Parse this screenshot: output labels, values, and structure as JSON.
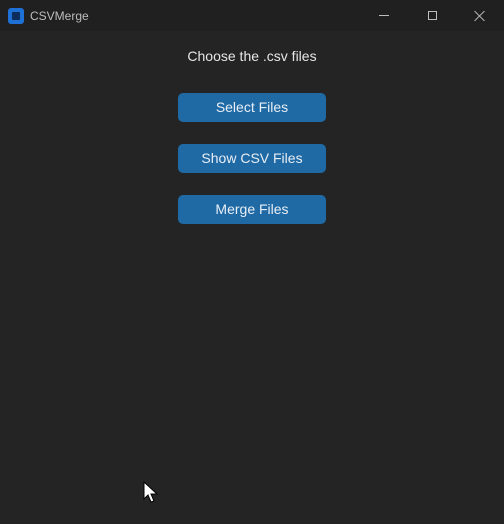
{
  "window": {
    "title": "CSVMerge",
    "icon": "app-icon",
    "controls": {
      "minimize": "minimize-icon",
      "maximize": "maximize-icon",
      "close": "close-icon"
    }
  },
  "main": {
    "heading": "Choose the .csv files",
    "buttons": {
      "select_label": "Select Files",
      "show_label": "Show CSV Files",
      "merge_label": "Merge Files"
    }
  },
  "colors": {
    "background": "#242424",
    "titlebar": "#202020",
    "button": "#1f6aa5",
    "text": "#e6e6e6"
  }
}
